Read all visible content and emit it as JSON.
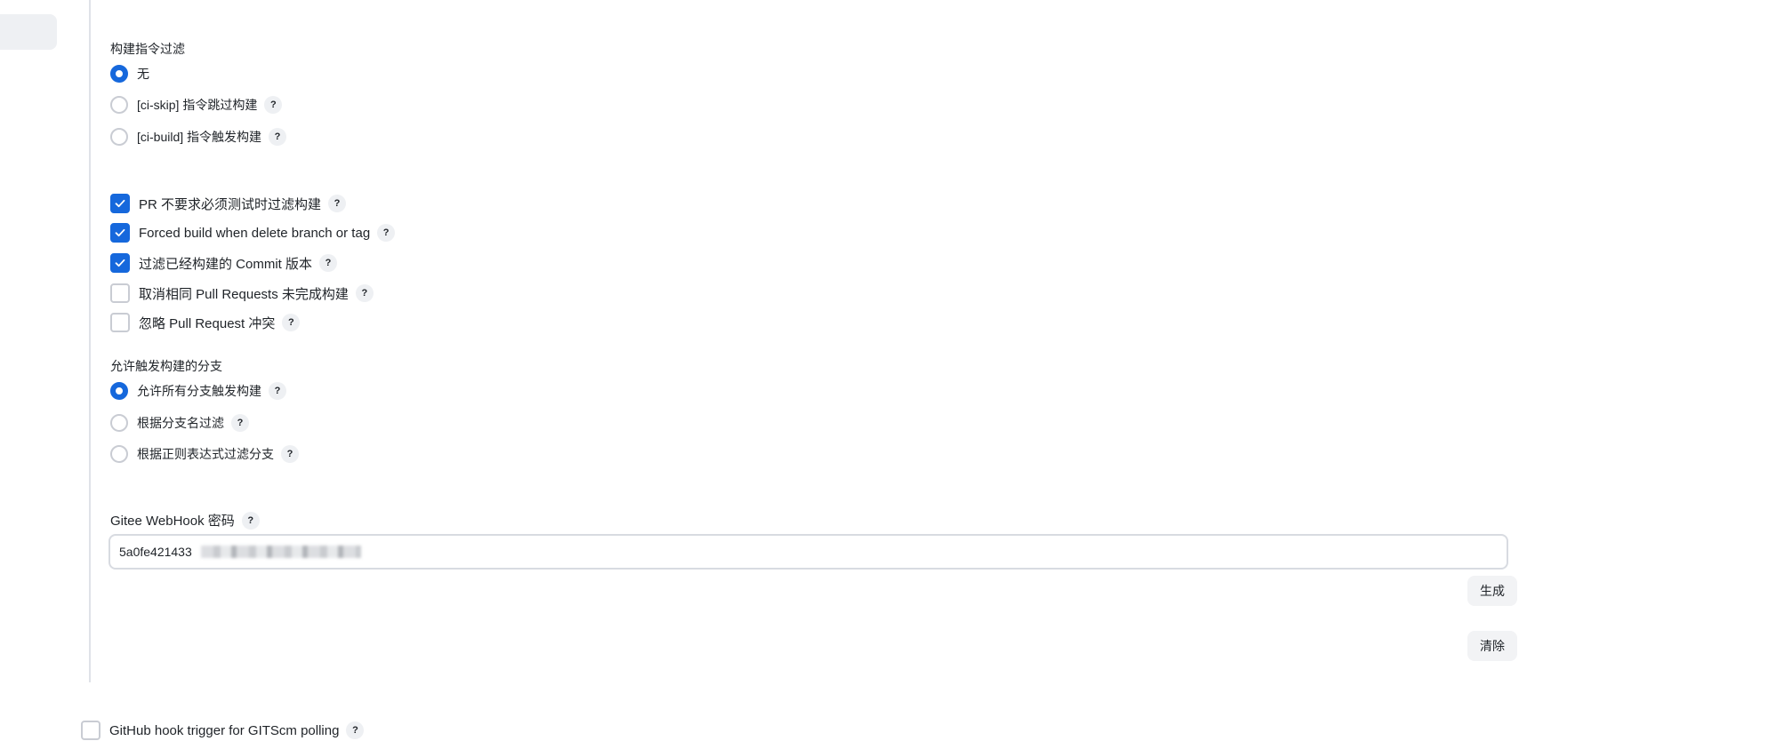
{
  "build_filter": {
    "label": "构建指令过滤",
    "options": [
      {
        "label": "无",
        "selected": true,
        "help": false
      },
      {
        "label": "[ci-skip] 指令跳过构建",
        "selected": false,
        "help": true
      },
      {
        "label": "[ci-build] 指令触发构建",
        "selected": false,
        "help": true
      }
    ]
  },
  "checkboxes": [
    {
      "label": "PR 不要求必须测试时过滤构建",
      "checked": true
    },
    {
      "label": "Forced build when delete branch or tag",
      "checked": true
    },
    {
      "label": "过滤已经构建的 Commit 版本",
      "checked": true
    },
    {
      "label": "取消相同 Pull Requests 未完成构建",
      "checked": false
    },
    {
      "label": "忽略 Pull Request 冲突",
      "checked": false
    }
  ],
  "branch_trigger": {
    "label": "允许触发构建的分支",
    "options": [
      {
        "label": "允许所有分支触发构建",
        "selected": true
      },
      {
        "label": "根据分支名过滤",
        "selected": false
      },
      {
        "label": "根据正则表达式过滤分支",
        "selected": false
      }
    ]
  },
  "webhook": {
    "label": "Gitee WebHook 密码",
    "value": "5a0fe421433",
    "generate_label": "生成",
    "clear_label": "清除"
  },
  "github_hook": {
    "label": "GitHub hook trigger for GITScm polling",
    "checked": false
  },
  "help_glyph": "?",
  "colors": {
    "accent": "#1668dc",
    "muted_bg": "#eef0f3",
    "border": "#c9ccd3"
  }
}
